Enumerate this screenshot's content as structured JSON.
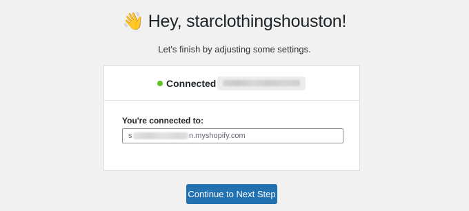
{
  "header": {
    "wave_emoji": "👋",
    "title": "Hey, starclothingshouston!",
    "subtitle": "Let's finish by adjusting some settings."
  },
  "connection": {
    "status_label": "Connected",
    "status_color": "#5ec225",
    "connected_to_label": "You're connected to:",
    "store_url_prefix": "s",
    "store_url_suffix": "n.myshopify.com"
  },
  "actions": {
    "next_button_label": "Continue to Next Step",
    "accent_color": "#2271b1"
  }
}
